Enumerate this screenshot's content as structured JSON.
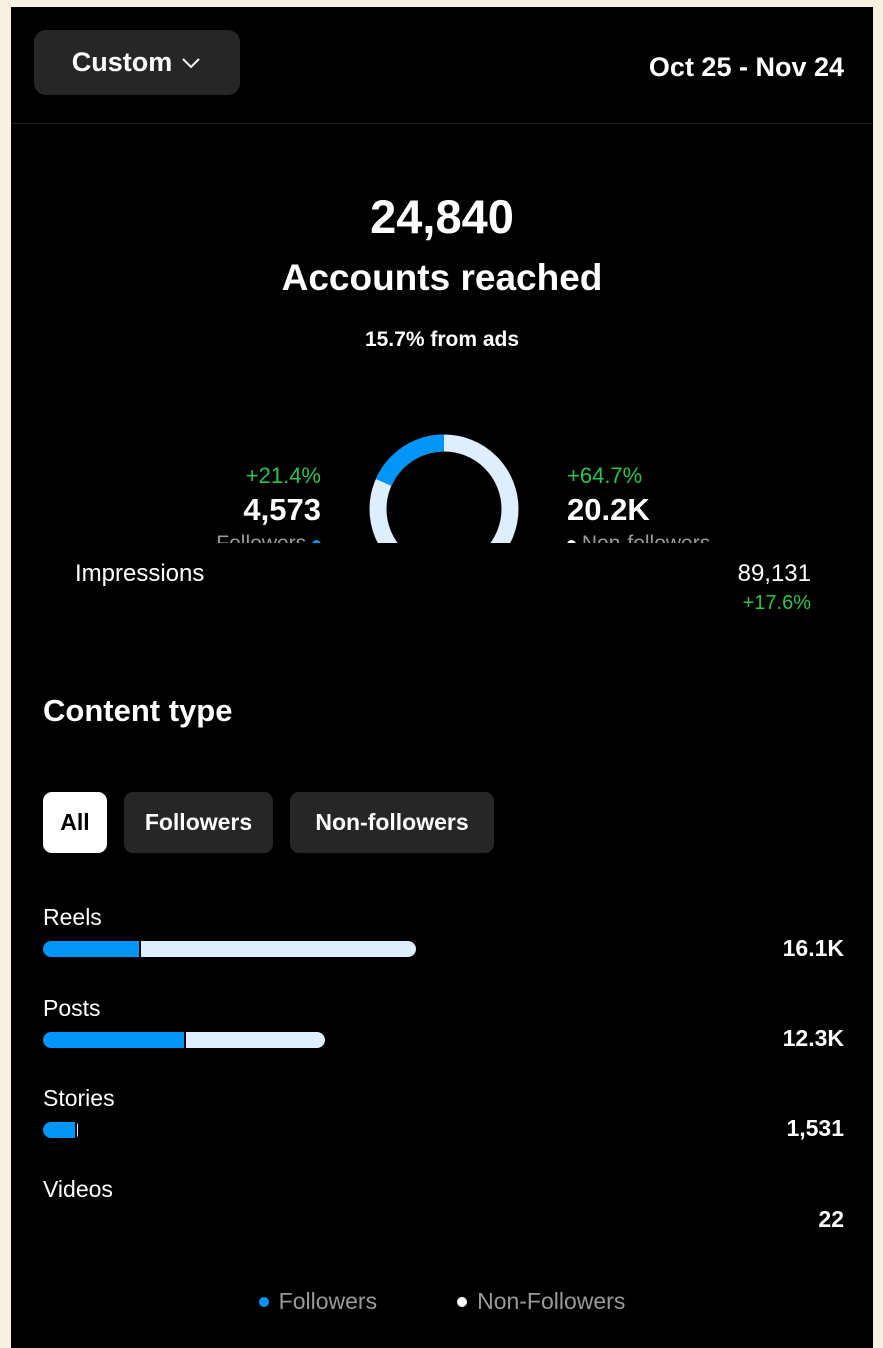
{
  "header": {
    "range_button_label": "Custom",
    "date_range": "Oct 25 - Nov 24"
  },
  "summary": {
    "accounts_reached_value": "24,840",
    "accounts_reached_label": "Accounts reached",
    "from_ads": "15.7% from ads"
  },
  "donut": {
    "followers": {
      "change": "+21.4%",
      "value": "4,573",
      "label": "Followers",
      "share": 0.184
    },
    "non_followers": {
      "change": "+64.7%",
      "value": "20.2K",
      "label": "Non-followers",
      "share": 0.816
    }
  },
  "impressions": {
    "label": "Impressions",
    "value": "89,131",
    "change": "+17.6%"
  },
  "content_type": {
    "title": "Content type",
    "filters": [
      "All",
      "Followers",
      "Non-followers"
    ],
    "active_filter": "All",
    "rows": [
      {
        "label": "Reels",
        "value": "16.1K"
      },
      {
        "label": "Posts",
        "value": "12.3K"
      },
      {
        "label": "Stories",
        "value": "1,531"
      },
      {
        "label": "Videos",
        "value": "22"
      }
    ]
  },
  "legend": {
    "followers": "Followers",
    "non_followers": "Non-Followers"
  },
  "colors": {
    "followers": "#0095f6",
    "non_followers": "#dfeefd",
    "positive_change": "#2fc14c",
    "chip_background": "#262626",
    "screen_background": "#000000"
  }
}
